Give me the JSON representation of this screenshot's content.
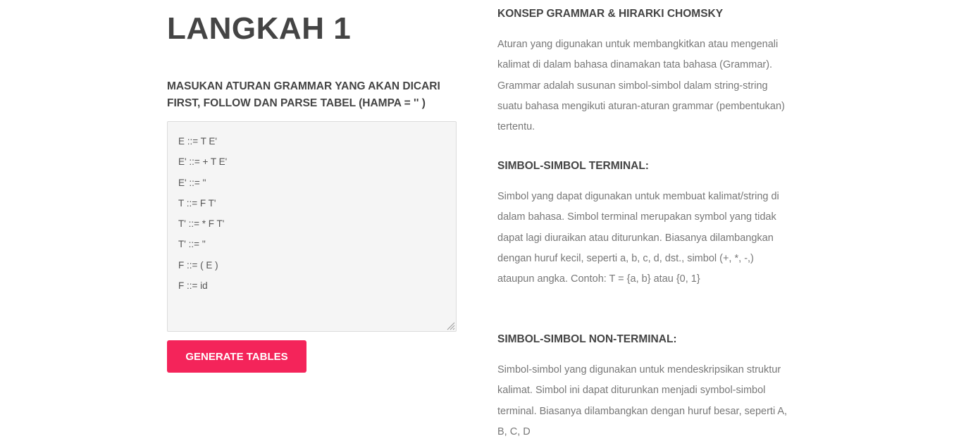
{
  "left": {
    "step_title": "LANGKAH 1",
    "instruction": "MASUKAN ATURAN GRAMMAR YANG AKAN DICARI FIRST, FOLLOW DAN PARSE TABEL (HAMPA = '' )",
    "grammar_lines": [
      "E ::= T E'",
      "E' ::= + T E'",
      "E' ::= ''",
      "T ::= F T'",
      "T' ::= * F T'",
      "T' ::= ''",
      "F ::= ( E )",
      "F ::= id"
    ],
    "generate_label": "GENERATE TABLES",
    "button_color": "#f4245a"
  },
  "right": {
    "sections": [
      {
        "heading": "KONSEP GRAMMAR & HIRARKI CHOMSKY",
        "text": "Aturan yang digunakan untuk membangkitkan atau mengenali kalimat di dalam bahasa dinamakan tata bahasa (Grammar). Grammar adalah susunan simbol-simbol dalam string-string suatu bahasa mengikuti aturan-aturan grammar (pembentukan) tertentu."
      },
      {
        "heading": "SIMBOL-SIMBOL TERMINAL:",
        "text": "Simbol yang dapat digunakan untuk membuat kalimat/string di dalam bahasa. Simbol terminal merupakan symbol yang tidak dapat lagi diuraikan atau diturunkan. Biasanya dilambangkan dengan huruf kecil, seperti a, b, c, d, dst., simbol (+, *, -,) ataupun angka. Contoh: T = {a, b} atau {0, 1}"
      },
      {
        "heading": "SIMBOL-SIMBOL NON-TERMINAL:",
        "text": "Simbol-simbol yang digunakan untuk mendeskripsikan struktur kalimat. Simbol ini dapat diturunkan menjadi symbol-simbol terminal. Biasanya dilambangkan dengan huruf besar, seperti A, B, C, D"
      }
    ]
  }
}
